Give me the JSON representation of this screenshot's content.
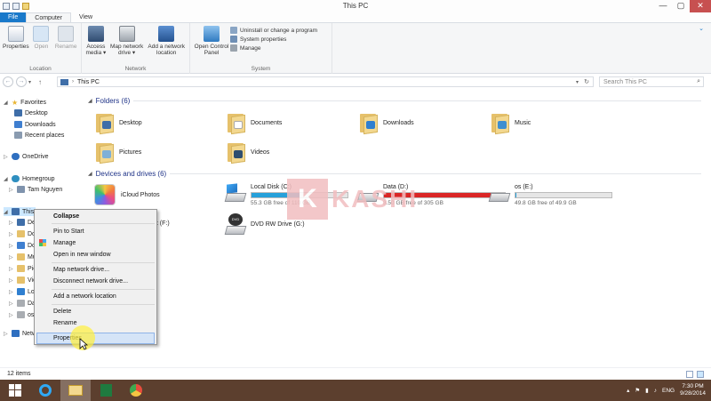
{
  "window": {
    "title": "This PC",
    "minimize": "—",
    "maximize": "▢",
    "close": "✕"
  },
  "tabs": [
    {
      "label": "File"
    },
    {
      "label": "Computer"
    },
    {
      "label": "View"
    }
  ],
  "ribbon": {
    "location": {
      "label": "Location",
      "buttons": [
        {
          "label": "Properties"
        },
        {
          "label": "Open"
        },
        {
          "label": "Rename"
        }
      ]
    },
    "network": {
      "label": "Network",
      "buttons": [
        {
          "label": "Access media ▾"
        },
        {
          "label": "Map network drive ▾"
        },
        {
          "label": "Add a network location"
        }
      ]
    },
    "system": {
      "label": "System",
      "open_control_panel": "Open Control Panel",
      "items": [
        {
          "label": "Uninstall or change a program"
        },
        {
          "label": "System properties"
        },
        {
          "label": "Manage"
        }
      ]
    }
  },
  "address": {
    "path": "This PC",
    "search_placeholder": "Search This PC"
  },
  "nav": {
    "favorites": "Favorites",
    "favorites_items": [
      {
        "label": "Desktop"
      },
      {
        "label": "Downloads"
      },
      {
        "label": "Recent places"
      }
    ],
    "onedrive": "OneDrive",
    "homegroup": "Homegroup",
    "homegroup_user": "Tam Nguyen",
    "thispc": "This",
    "thispc_children": [
      "De",
      "Do",
      "Do",
      "Mu",
      "Pic",
      "Vid",
      "Loc",
      "Dat",
      "os"
    ],
    "network": "Netw"
  },
  "folders": {
    "header": "Folders (6)",
    "items": [
      {
        "label": "Desktop"
      },
      {
        "label": "Documents"
      },
      {
        "label": "Downloads"
      },
      {
        "label": "Music"
      },
      {
        "label": "Pictures"
      },
      {
        "label": "Videos"
      }
    ]
  },
  "drives": {
    "header": "Devices and drives (6)",
    "icloud": "iCloud Photos",
    "partial_label": "et (F:)",
    "items": [
      {
        "name": "Local Disk (C:)",
        "free": "55.3 GB free of 110 GB",
        "used_fraction": 0.5,
        "color": "#26a0da"
      },
      {
        "name": "Data (D:)",
        "free": "3.50 GB free of 305 GB",
        "used_fraction": 0.99,
        "color": "#da2626"
      },
      {
        "name": "os (E:)",
        "free": "49.8 GB free of 49.9 GB",
        "used_fraction": 0.01,
        "color": "#26a0da"
      }
    ],
    "dvd": "DVD RW Drive (G:)"
  },
  "context_menu": {
    "items": [
      {
        "label": "Collapse"
      },
      {
        "label": "Pin to Start"
      },
      {
        "label": "Manage"
      },
      {
        "label": "Open in new window"
      },
      {
        "label": "Map network drive..."
      },
      {
        "label": "Disconnect network drive..."
      },
      {
        "label": "Add a network location"
      },
      {
        "label": "Delete"
      },
      {
        "label": "Rename"
      },
      {
        "label": "Properties"
      }
    ]
  },
  "watermark": {
    "letter": "K",
    "text": "KASHI"
  },
  "status": {
    "count": "12 items"
  },
  "taskbar": {
    "lang": "ENG",
    "time": "7:30 PM",
    "date": "9/28/2014"
  },
  "colors": {
    "accent": "#1979ca",
    "taskbar": "#5c3f2e",
    "disk_ok": "#26a0da",
    "disk_full": "#da2626"
  }
}
